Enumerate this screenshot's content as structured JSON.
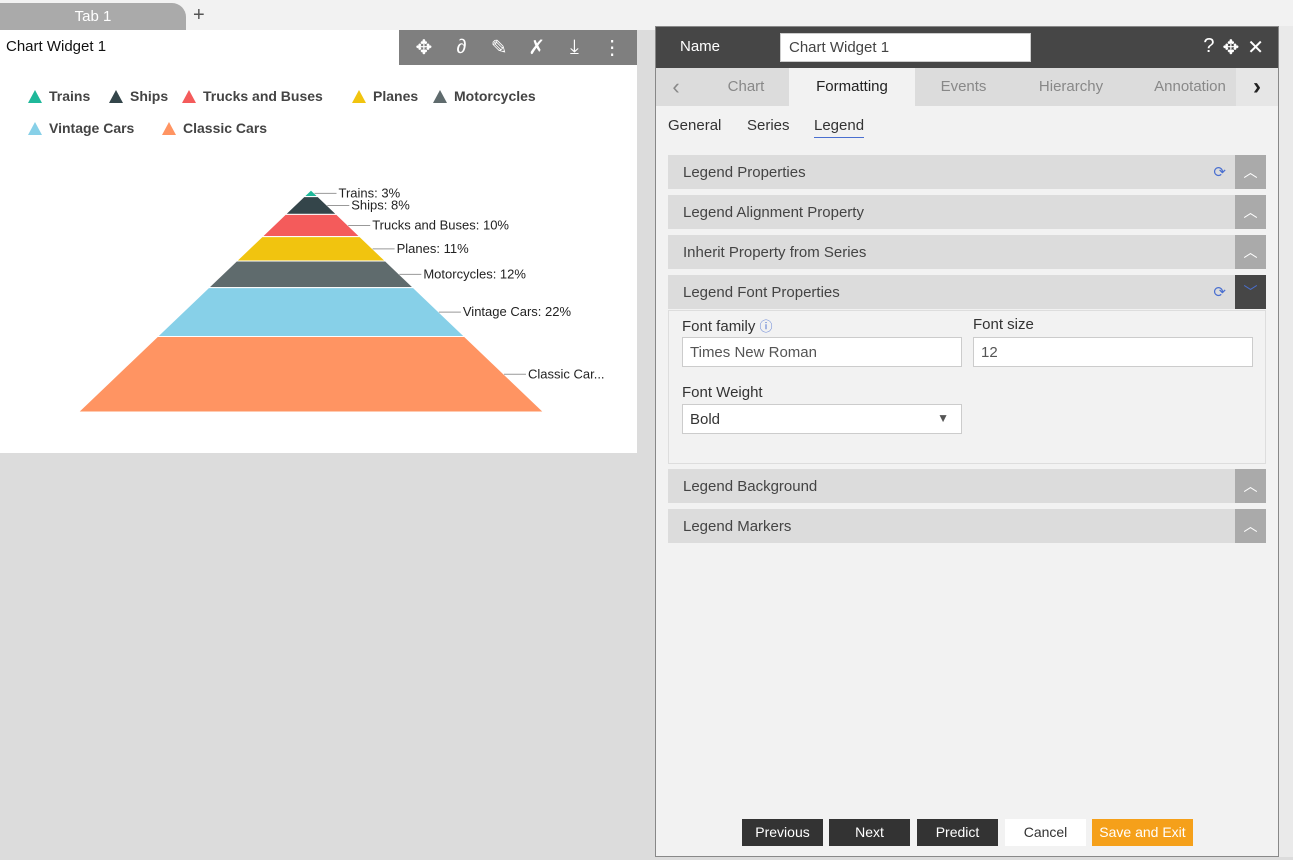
{
  "tabs": {
    "tab1": "Tab 1",
    "add": "+"
  },
  "widget": {
    "title": "Chart Widget 1",
    "tools": [
      "move-icon",
      "link-icon",
      "edit-icon",
      "tools-icon",
      "download-icon",
      "more-icon"
    ]
  },
  "chart_data": {
    "type": "pyramid",
    "categories": [
      "Trains",
      "Ships",
      "Trucks and Buses",
      "Planes",
      "Motorcycles",
      "Vintage Cars",
      "Classic Cars"
    ],
    "values": [
      3,
      8,
      10,
      11,
      12,
      22,
      34
    ],
    "colors": [
      "#1fb89a",
      "#34454a",
      "#f45b5b",
      "#f1c40f",
      "#5f6b6d",
      "#87d0e8",
      "#ff9462"
    ],
    "data_labels": [
      "Trains: 3%",
      "Ships: 8%",
      "Trucks and Buses: 10%",
      "Planes: 11%",
      "Motorcycles: 12%",
      "Vintage Cars: 22%",
      "Classic Car..."
    ],
    "legend": "top-left"
  },
  "panel": {
    "name_label": "Name",
    "name_value": "Chart Widget 1",
    "tabs": [
      "Chart",
      "Formatting",
      "Events",
      "Hierarchy",
      "Annotation"
    ],
    "subtabs": [
      "General",
      "Series",
      "Legend"
    ],
    "sections": [
      "Legend Properties",
      "Legend Alignment Property",
      "Inherit Property from Series",
      "Legend Font Properties",
      "Legend Background",
      "Legend Markers"
    ],
    "font_family_label": "Font family",
    "font_family_value": "Times New Roman",
    "font_size_label": "Font size",
    "font_size_value": "12",
    "font_weight_label": "Font Weight",
    "font_weight_value": "Bold",
    "buttons": {
      "previous": "Previous",
      "next": "Next",
      "predict": "Predict",
      "cancel": "Cancel",
      "save": "Save and Exit"
    },
    "accent": "#f5a01a"
  }
}
